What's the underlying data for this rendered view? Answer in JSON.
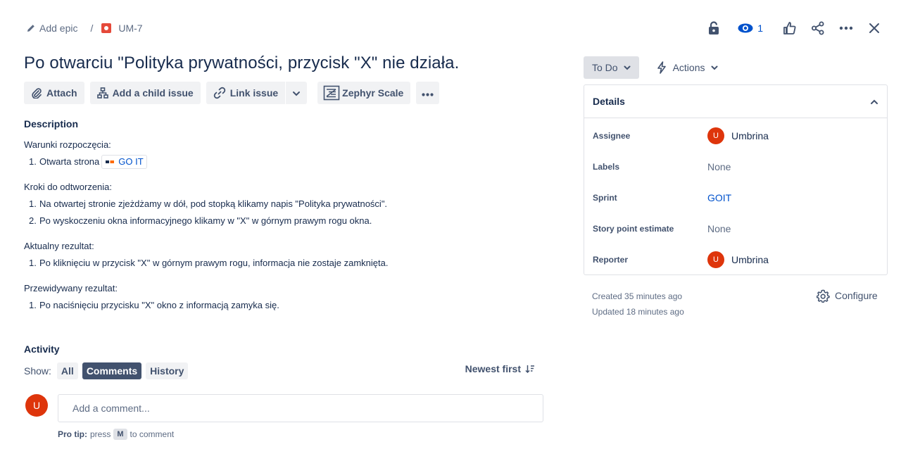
{
  "breadcrumb": {
    "add_epic": "Add epic",
    "separator": "/",
    "issue_key": "UM-7"
  },
  "toolbar": {
    "watch_count": "1",
    "icons": [
      "lock-icon",
      "eye-icon",
      "like-icon",
      "share-icon",
      "more-icon",
      "close-icon"
    ]
  },
  "issue": {
    "title": "Po otwarciu \"Polityka prywatności, przycisk \"X\" nie działa."
  },
  "actions": {
    "attach": "Attach",
    "add_child": "Add a child issue",
    "link_issue": "Link issue",
    "zephyr": "Zephyr Scale"
  },
  "description": {
    "heading": "Description",
    "sections": [
      {
        "heading": "Warunki rozpoczęcia:",
        "items": [
          "Otwarta strona"
        ],
        "chip": "GO IT"
      },
      {
        "heading": "Kroki do odtworzenia:",
        "items": [
          "Na otwartej stronie zjeżdżamy w dół, pod stopką klikamy napis \"Polityka prywatności\".",
          "Po wyskoczeniu okna informacyjnego klikamy w \"X\" w górnym prawym rogu okna."
        ]
      },
      {
        "heading": "Aktualny rezultat:",
        "items": [
          "Po kliknięciu w przycisk \"X\" w górnym prawym rogu, informacja nie zostaje zamknięta."
        ]
      },
      {
        "heading": "Przewidywany rezultat:",
        "items": [
          "Po naciśnięciu przycisku \"X\" okno z informacją zamyka się."
        ]
      }
    ]
  },
  "activity": {
    "heading": "Activity",
    "show_label": "Show:",
    "filters": [
      "All",
      "Comments",
      "History"
    ],
    "active_filter": "Comments",
    "sort_label": "Newest first",
    "avatar_initial": "U",
    "comment_placeholder": "Add a comment...",
    "protip_label": "Pro tip:",
    "protip_press": "press",
    "protip_key": "M",
    "protip_tail": "to comment"
  },
  "sidebar": {
    "status": "To Do",
    "actions_label": "Actions",
    "details_heading": "Details",
    "fields": [
      {
        "label": "Assignee",
        "value": "Umbrina",
        "avatar": "U"
      },
      {
        "label": "Labels",
        "value": "None"
      },
      {
        "label": "Sprint",
        "value": "GOIT"
      },
      {
        "label": "Story point estimate",
        "value": "None"
      },
      {
        "label": "Reporter",
        "value": "Umbrina",
        "avatar": "U"
      }
    ],
    "created": "Created 35 minutes ago",
    "updated": "Updated 18 minutes ago",
    "configure": "Configure"
  },
  "colors": {
    "text": "#172b4d",
    "muted": "#5e6c84",
    "link": "#0052cc",
    "avatar": "#de350b",
    "active_filter_bg": "#42526e",
    "button_bg": "#f1f2f4"
  }
}
